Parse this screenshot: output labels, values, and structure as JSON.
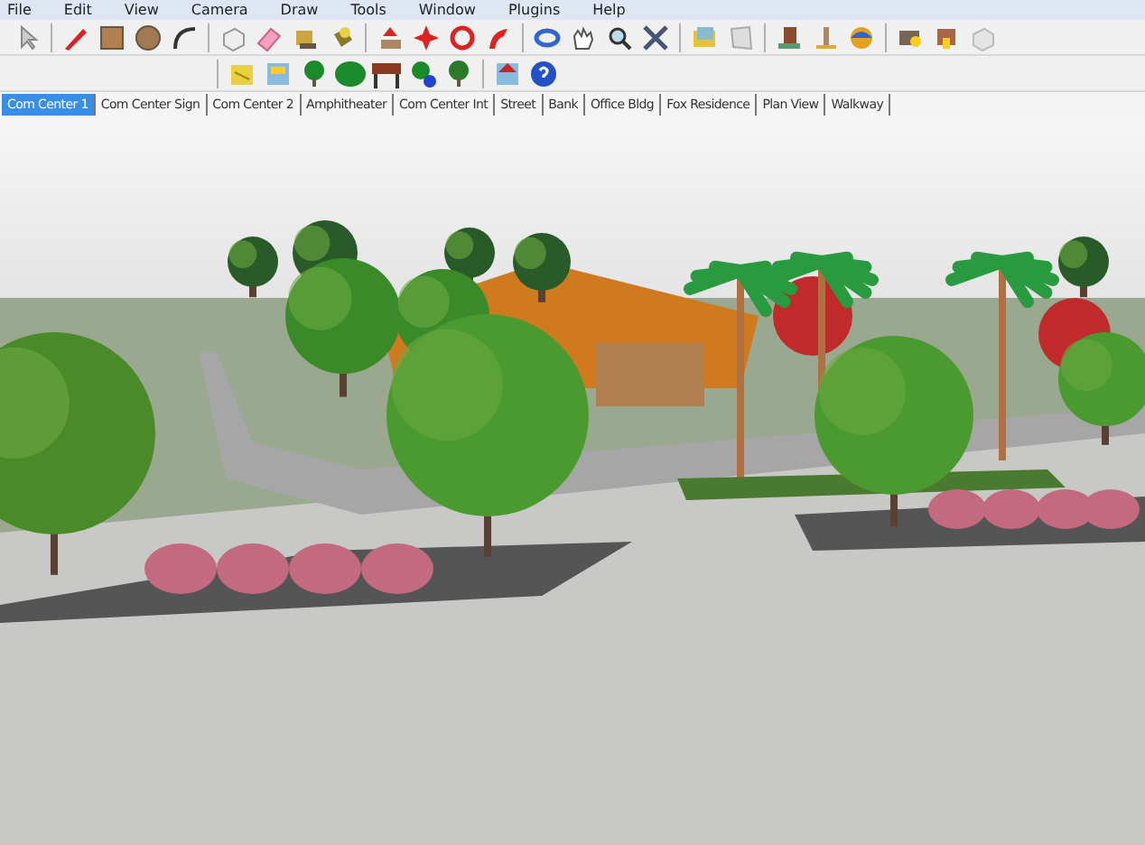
{
  "menu": [
    "File",
    "Edit",
    "View",
    "Camera",
    "Draw",
    "Tools",
    "Window",
    "Plugins",
    "Help"
  ],
  "scene_tabs": [
    {
      "label": "Com Center 1",
      "selected": true
    },
    {
      "label": "Com Center Sign",
      "selected": false
    },
    {
      "label": "Com Center 2",
      "selected": false
    },
    {
      "label": "Amphitheater",
      "selected": false
    },
    {
      "label": "Com Center Int",
      "selected": false
    },
    {
      "label": "Street",
      "selected": false
    },
    {
      "label": "Bank",
      "selected": false
    },
    {
      "label": "Office Bldg",
      "selected": false
    },
    {
      "label": "Fox Residence",
      "selected": false
    },
    {
      "label": "Plan View",
      "selected": false
    },
    {
      "label": "Walkway",
      "selected": false
    }
  ]
}
